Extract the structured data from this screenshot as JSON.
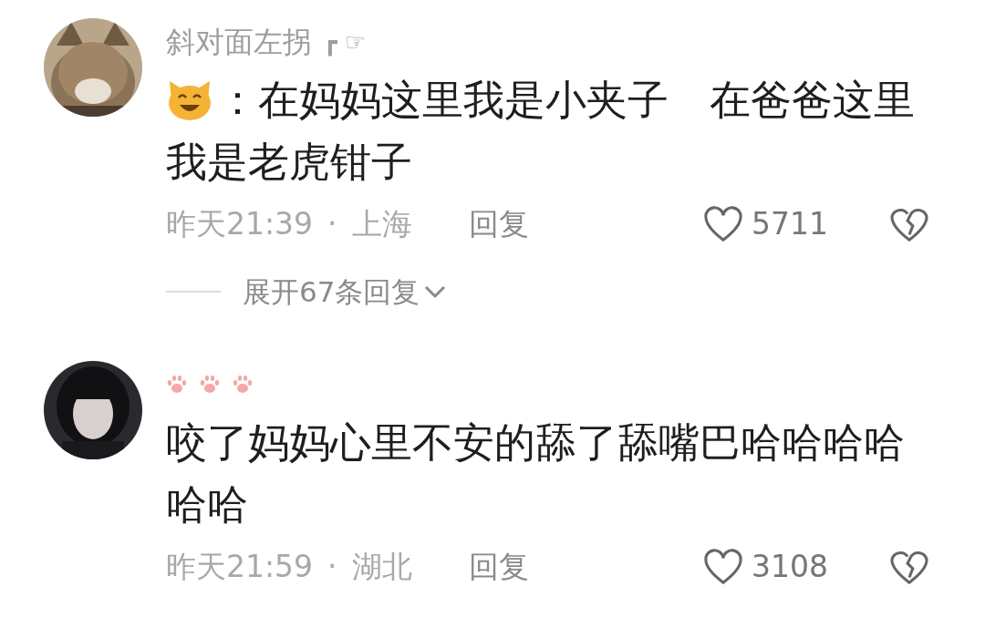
{
  "comments": [
    {
      "username": "斜对面左拐",
      "username_marks": "┏ ☞",
      "emoji_prefix": true,
      "text": "：在妈妈这里我是小夹子　在爸爸这里我是老虎钳子",
      "time": "昨天21:39",
      "separator": "·",
      "location": "上海",
      "reply": "回复",
      "likes": "5711",
      "expand": "展开67条回复"
    },
    {
      "text": "咬了妈妈心里不安的舔了舔嘴巴哈哈哈哈哈哈",
      "time": "昨天21:59",
      "separator": "·",
      "location": "湖北",
      "reply": "回复",
      "likes": "3108"
    }
  ]
}
